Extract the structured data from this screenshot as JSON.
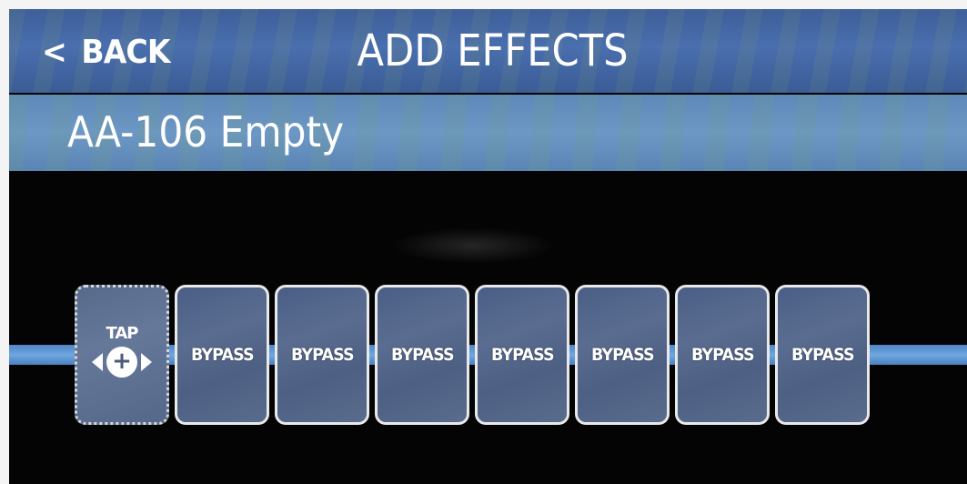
{
  "header": {
    "back_label": "BACK",
    "back_chevron": "<",
    "title": "ADD EFFECTS"
  },
  "preset": {
    "name": "AA-106 Empty"
  },
  "chain": {
    "tap_slot": {
      "label": "TAP",
      "icons": [
        "left-arrow-icon",
        "plus-circle-icon",
        "right-arrow-icon"
      ]
    },
    "effect_slots": [
      {
        "label": "BYPASS"
      },
      {
        "label": "BYPASS"
      },
      {
        "label": "BYPASS"
      },
      {
        "label": "BYPASS"
      },
      {
        "label": "BYPASS"
      },
      {
        "label": "BYPASS"
      },
      {
        "label": "BYPASS"
      }
    ]
  },
  "colors": {
    "header_bg": "#4a6fae",
    "preset_bar_bg": "#6d97c4",
    "signal_line": "#6fa7e0",
    "screen_bg": "#040404",
    "slot_border": "#e9e9e9"
  }
}
